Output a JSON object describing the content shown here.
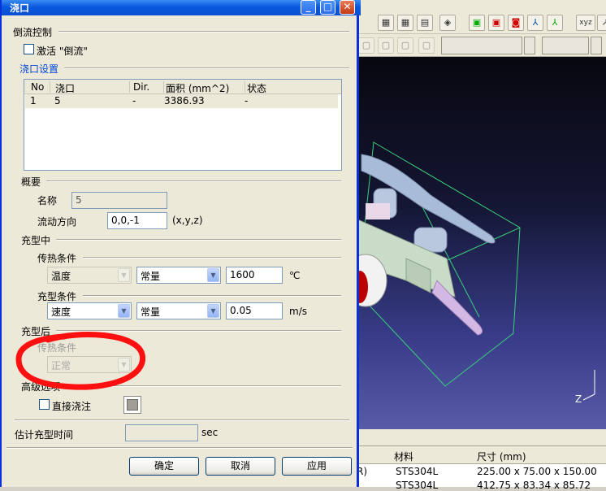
{
  "dialog": {
    "title": "浇口",
    "backflow_section": "倒流控制",
    "activate_backflow_label": "激活 \"倒流\"",
    "sprue_settings_section": "浇口设置",
    "table": {
      "columns": [
        "No",
        "浇口",
        "Dir.",
        "面积 (mm^2)",
        "状态"
      ],
      "rows": [
        [
          "1",
          "5",
          "-",
          "3386.93",
          "-"
        ]
      ]
    },
    "summary_section": "概要",
    "name_label": "名称",
    "name_value": "5",
    "flow_dir_label": "流动方向",
    "flow_dir_value": "0,0,-1",
    "flow_dir_unit": "(x,y,z)",
    "filling_section": "充型中",
    "heat_cond_label": "传热条件",
    "temp_combo": "温度",
    "const_combo1": "常量",
    "temp_value": "1600",
    "temp_unit": "℃",
    "fill_cond_label": "充型条件",
    "speed_combo": "速度",
    "const_combo2": "常量",
    "speed_value": "0.05",
    "speed_unit": "m/s",
    "after_fill_section": "充型后",
    "after_heat_label": "传热条件",
    "normal_combo": "正常",
    "advanced_section": "高级选项",
    "direct_pour_label": "直接浇注",
    "est_time_label": "估计充型时间",
    "est_time_unit": "sec",
    "ok_label": "确定",
    "cancel_label": "取消",
    "apply_label": "应用"
  },
  "background": {
    "toolbar_icons": [
      "grid-icon",
      "grid-icon",
      "grid-icon",
      "layers-icon",
      "view-icon",
      "view-icon",
      "view-icon",
      "axis-icon",
      "axis-icon",
      "xyz-icon"
    ],
    "xyz_label": "xyz",
    "axis_z_label": "Z",
    "table_header": {
      "material": "材料",
      "size": "尺寸 (mm)"
    },
    "table_rows": [
      {
        "tail": "R)",
        "material": "STS304L",
        "size": "225.00 x 75.00 x 150.00"
      },
      {
        "tail": "",
        "material": "STS304L",
        "size": "412.75 x 83.34 x 85.72"
      }
    ]
  },
  "annotation_color": "#ff1010"
}
